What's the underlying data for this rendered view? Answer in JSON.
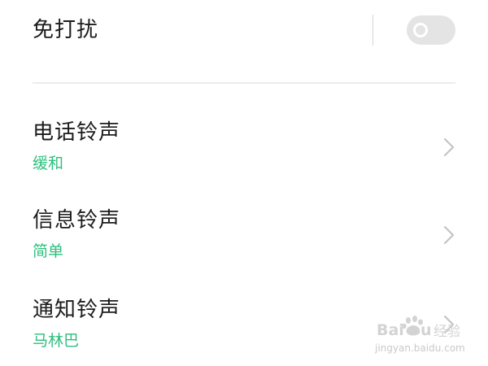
{
  "dnd": {
    "label": "免打扰",
    "enabled": false
  },
  "settings": [
    {
      "title": "电话铃声",
      "value": "缓和",
      "icon": "chevron-right-icon"
    },
    {
      "title": "信息铃声",
      "value": "简单",
      "icon": "chevron-right-icon"
    },
    {
      "title": "通知铃声",
      "value": "马林巴",
      "icon": "chevron-right-icon"
    }
  ],
  "watermark": {
    "logo_text": "Baidu经验",
    "url": "jingyan.baidu.com"
  },
  "colors": {
    "background": "#ffffff",
    "title_text": "#1c1c1c",
    "value_accent": "#2dbf7e",
    "toggle_off": "#e4e4e4",
    "divider": "#ececec",
    "chevron": "#c4c4c4"
  }
}
